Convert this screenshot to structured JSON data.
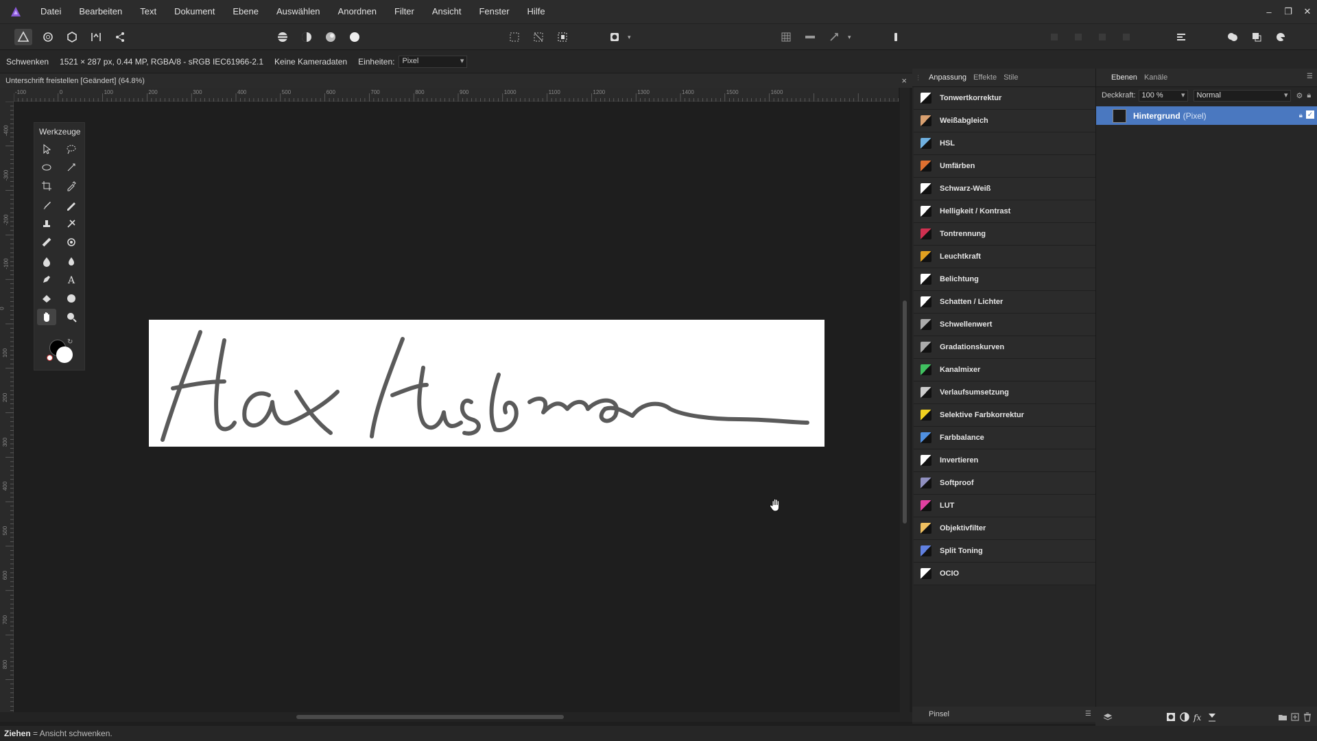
{
  "menu": [
    "Datei",
    "Bearbeiten",
    "Text",
    "Dokument",
    "Ebene",
    "Auswählen",
    "Anordnen",
    "Filter",
    "Ansicht",
    "Fenster",
    "Hilfe"
  ],
  "context": {
    "tool_name": "Schwenken",
    "doc_info": "1521 × 287 px, 0.44 MP, RGBA/8 - sRGB IEC61966-2.1",
    "camera": "Keine Kameradaten",
    "units_label": "Einheiten:",
    "units_value": "Pixel"
  },
  "doctab": {
    "title": "Unterschrift freistellen [Geändert] (64.8%)",
    "close": "×"
  },
  "ruler_top": [
    "-100",
    "0",
    "100",
    "200",
    "300",
    "400",
    "500",
    "600",
    "700",
    "800",
    "900",
    "1000",
    "1100",
    "1200",
    "1300",
    "1400",
    "1500",
    "1600"
  ],
  "ruler_left": [
    "-400",
    "-300",
    "-200",
    "-100",
    "0",
    "100",
    "200",
    "300",
    "400",
    "500",
    "600",
    "700",
    "800"
  ],
  "tools_panel": {
    "title": "Werkzeuge"
  },
  "adjustments": {
    "tabs": [
      "Anpassung",
      "Effekte",
      "Stile"
    ],
    "items": [
      {
        "label": "Tonwertkorrektur",
        "color": "#ffffff"
      },
      {
        "label": "Weißabgleich",
        "color": "#d9a070"
      },
      {
        "label": "HSL",
        "color": "#6fb0e0"
      },
      {
        "label": "Umfärben",
        "color": "#e07030"
      },
      {
        "label": "Schwarz-Weiß",
        "color": "#ffffff"
      },
      {
        "label": "Helligkeit / Kontrast",
        "color": "#ffffff"
      },
      {
        "label": "Tontrennung",
        "color": "#d03050"
      },
      {
        "label": "Leuchtkraft",
        "color": "#e0a020"
      },
      {
        "label": "Belichtung",
        "color": "#ffffff"
      },
      {
        "label": "Schatten / Lichter",
        "color": "#ffffff"
      },
      {
        "label": "Schwellenwert",
        "color": "#aaaaaa"
      },
      {
        "label": "Gradationskurven",
        "color": "#aaaaaa"
      },
      {
        "label": "Kanalmixer",
        "color": "#40c060"
      },
      {
        "label": "Verlaufsumsetzung",
        "color": "#cccccc"
      },
      {
        "label": "Selektive Farbkorrektur",
        "color": "#f0d020"
      },
      {
        "label": "Farbbalance",
        "color": "#5090e0"
      },
      {
        "label": "Invertieren",
        "color": "#ffffff"
      },
      {
        "label": "Softproof",
        "color": "#9090c0"
      },
      {
        "label": "LUT",
        "color": "#e040a0"
      },
      {
        "label": "Objektivfilter",
        "color": "#f0c060"
      },
      {
        "label": "Split Toning",
        "color": "#6080e0"
      },
      {
        "label": "OCIO",
        "color": "#ffffff"
      }
    ]
  },
  "layers": {
    "tabs": [
      "Ebenen",
      "Kanäle"
    ],
    "opacity_label": "Deckkraft:",
    "opacity_value": "100 %",
    "blend_mode": "Normal",
    "layer_name": "Hintergrund",
    "layer_type": "(Pixel)"
  },
  "brush_panel": "Pinsel",
  "status": {
    "bold": "Ziehen",
    "text": " = Ansicht schwenken."
  }
}
